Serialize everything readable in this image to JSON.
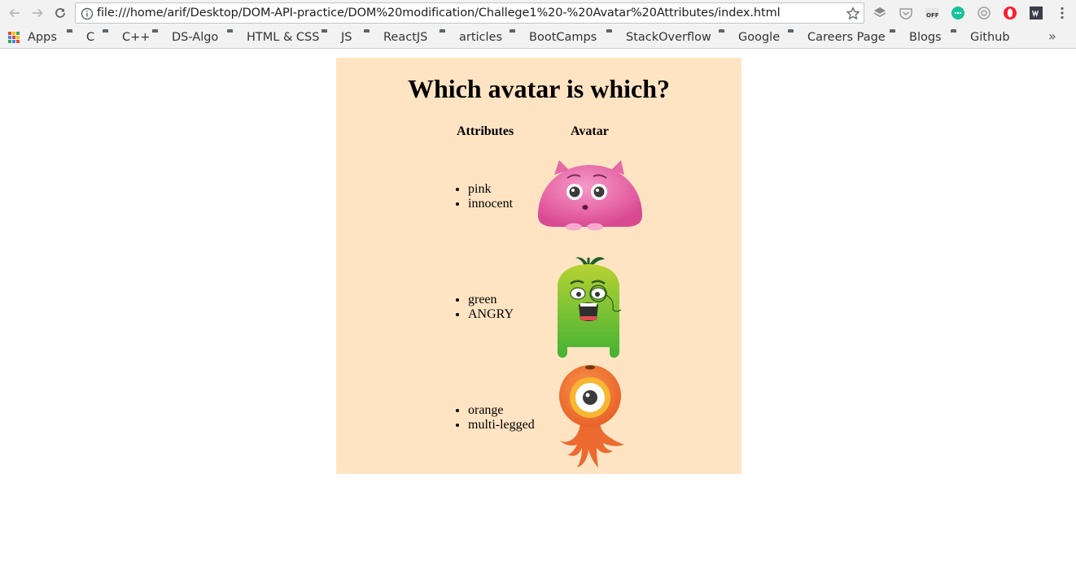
{
  "browser": {
    "url": "file:///home/arif/Desktop/DOM-API-practice/DOM%20modification/Challege1%20-%20Avatar%20Attributes/index.html",
    "bookmarks": [
      {
        "label": "Apps",
        "icon": "apps-grid-icon"
      },
      {
        "label": "C",
        "icon": "folder-icon"
      },
      {
        "label": "C++",
        "icon": "folder-icon"
      },
      {
        "label": "DS-Algo",
        "icon": "folder-icon"
      },
      {
        "label": "HTML & CSS",
        "icon": "folder-icon"
      },
      {
        "label": "JS",
        "icon": "folder-icon"
      },
      {
        "label": "ReactJS",
        "icon": "folder-icon"
      },
      {
        "label": "articles",
        "icon": "folder-icon"
      },
      {
        "label": "BootCamps",
        "icon": "folder-icon"
      },
      {
        "label": "StackOverflow",
        "icon": "folder-icon"
      },
      {
        "label": "Google",
        "icon": "folder-icon"
      },
      {
        "label": "Careers Page",
        "icon": "folder-icon"
      },
      {
        "label": "Blogs",
        "icon": "folder-icon"
      },
      {
        "label": "Github",
        "icon": "folder-icon"
      }
    ],
    "more_label": "»"
  },
  "page": {
    "title": "Which avatar is which?",
    "background": "#ffe4c4",
    "headers": {
      "attributes": "Attributes",
      "avatar": "Avatar"
    },
    "rows": [
      {
        "attributes": [
          "pink",
          "innocent"
        ],
        "avatar": "pink-monster-avatar"
      },
      {
        "attributes": [
          "green",
          "ANGRY"
        ],
        "avatar": "green-monster-avatar"
      },
      {
        "attributes": [
          "orange",
          "multi-legged"
        ],
        "avatar": "orange-monster-avatar"
      }
    ]
  }
}
